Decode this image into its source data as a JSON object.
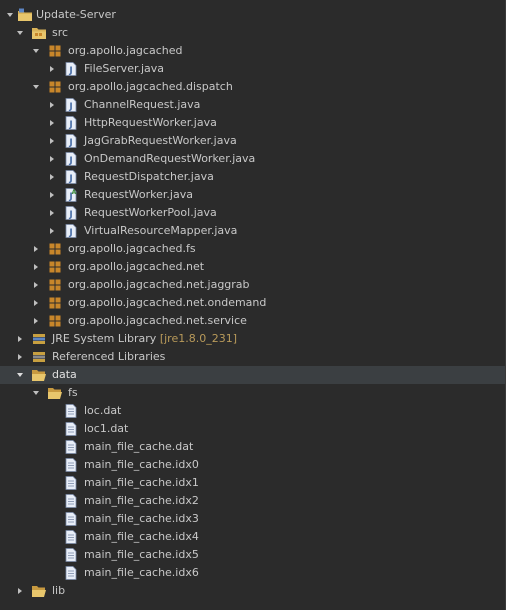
{
  "tree": {
    "project": {
      "label": "Update-Server",
      "icon": "project-folder-icon"
    },
    "src": {
      "label": "src",
      "icon": "source-folder-icon"
    },
    "packages_top": [
      {
        "label": "org.apollo.jagcached",
        "icon": "package-icon",
        "files": [
          "FileServer.java"
        ]
      },
      {
        "label": "org.apollo.jagcached.dispatch",
        "icon": "package-icon",
        "files": [
          "ChannelRequest.java",
          "HttpRequestWorker.java",
          "JagGrabRequestWorker.java",
          "OnDemandRequestWorker.java",
          "RequestDispatcher.java",
          "RequestWorker.java",
          "RequestWorkerPool.java",
          "VirtualResourceMapper.java"
        ]
      }
    ],
    "packages_collapsed": [
      "org.apollo.jagcached.fs",
      "org.apollo.jagcached.net",
      "org.apollo.jagcached.net.jaggrab",
      "org.apollo.jagcached.net.ondemand",
      "org.apollo.jagcached.net.service"
    ],
    "jre": {
      "label": "JRE System Library",
      "suffix": "[jre1.8.0_231]",
      "icon": "library-icon"
    },
    "referenced": {
      "label": "Referenced Libraries",
      "icon": "library-icon"
    },
    "data": {
      "label": "data",
      "icon": "folder-icon"
    },
    "fs": {
      "label": "fs",
      "icon": "folder-icon"
    },
    "fs_files": [
      "loc.dat",
      "loc1.dat",
      "main_file_cache.dat",
      "main_file_cache.idx0",
      "main_file_cache.idx1",
      "main_file_cache.idx2",
      "main_file_cache.idx3",
      "main_file_cache.idx4",
      "main_file_cache.idx5",
      "main_file_cache.idx6"
    ],
    "lib": {
      "label": "lib",
      "icon": "folder-icon"
    }
  },
  "colors": {
    "background": "#2b2b2b",
    "text": "#c8c8c8",
    "selected_row": "#3b3f42",
    "library_suffix": "#b89a5a",
    "package_icon": "#c8862a",
    "java_icon_bg": "#e8eef8",
    "java_icon_letter": "#4a6fa8",
    "folder_icon": "#d9b358"
  }
}
